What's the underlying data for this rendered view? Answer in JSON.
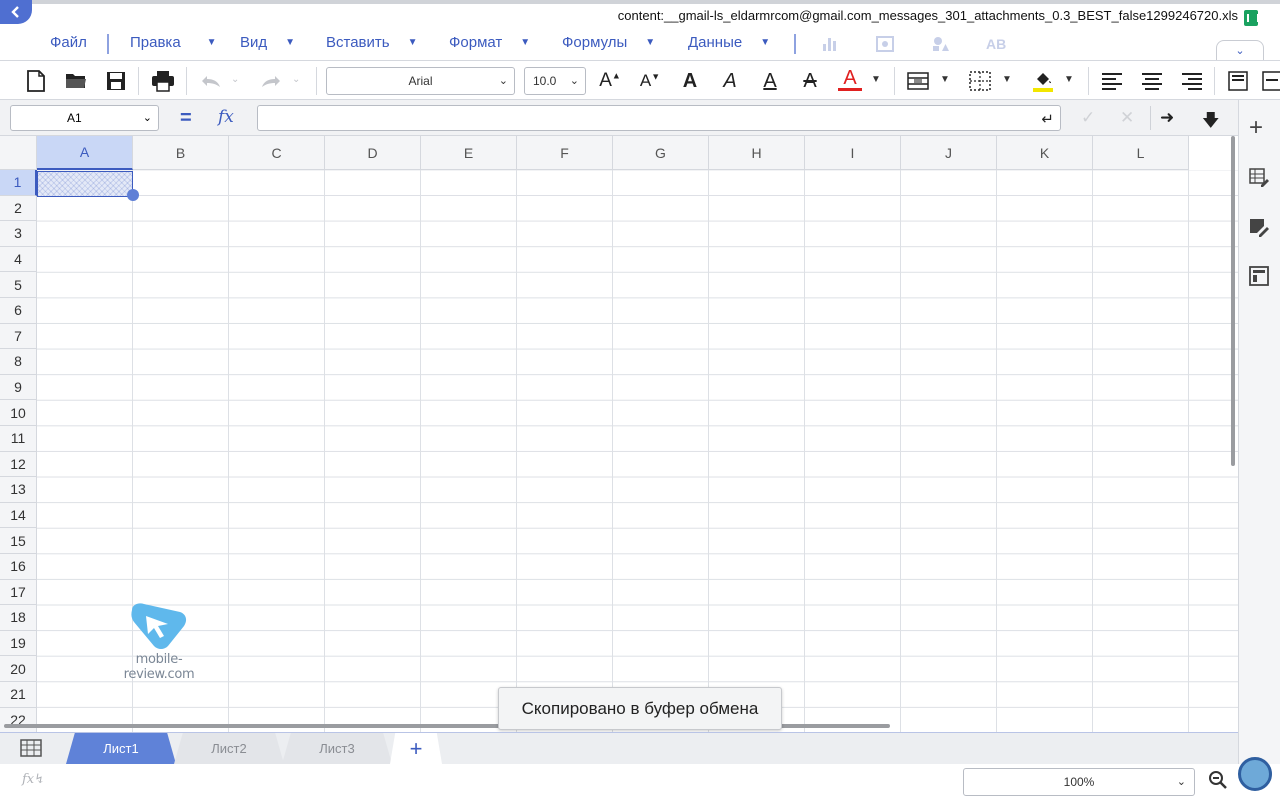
{
  "title": "content:__gmail-ls_eldarmrcom@gmail.com_messages_301_attachments_0.3_BEST_false1299246720.xls",
  "menu": [
    "Файл",
    "Правка",
    "Вид",
    "Вставить",
    "Формат",
    "Формулы",
    "Данные"
  ],
  "toolbar": {
    "font": "Arial",
    "size": "10.0"
  },
  "formula_bar": {
    "cell_ref": "A1",
    "formula": ""
  },
  "columns": [
    "A",
    "B",
    "C",
    "D",
    "E",
    "F",
    "G",
    "H",
    "I",
    "J",
    "K",
    "L"
  ],
  "rows": [
    "1",
    "2",
    "3",
    "4",
    "5",
    "6",
    "7",
    "8",
    "9",
    "10",
    "11",
    "12",
    "13",
    "14",
    "15",
    "16",
    "17",
    "18",
    "19",
    "20",
    "21",
    "22"
  ],
  "selected_cell": "A1",
  "watermark": "mobile-review.com",
  "toast": "Скопировано в буфер обмена",
  "sheets": [
    "Лист1",
    "Лист2",
    "Лист3"
  ],
  "active_sheet": "Лист1",
  "zoom": "100%",
  "colors": {
    "accent": "#3c5bbf",
    "active_tab": "#5f82d8",
    "selection": "#c9d7f6"
  }
}
